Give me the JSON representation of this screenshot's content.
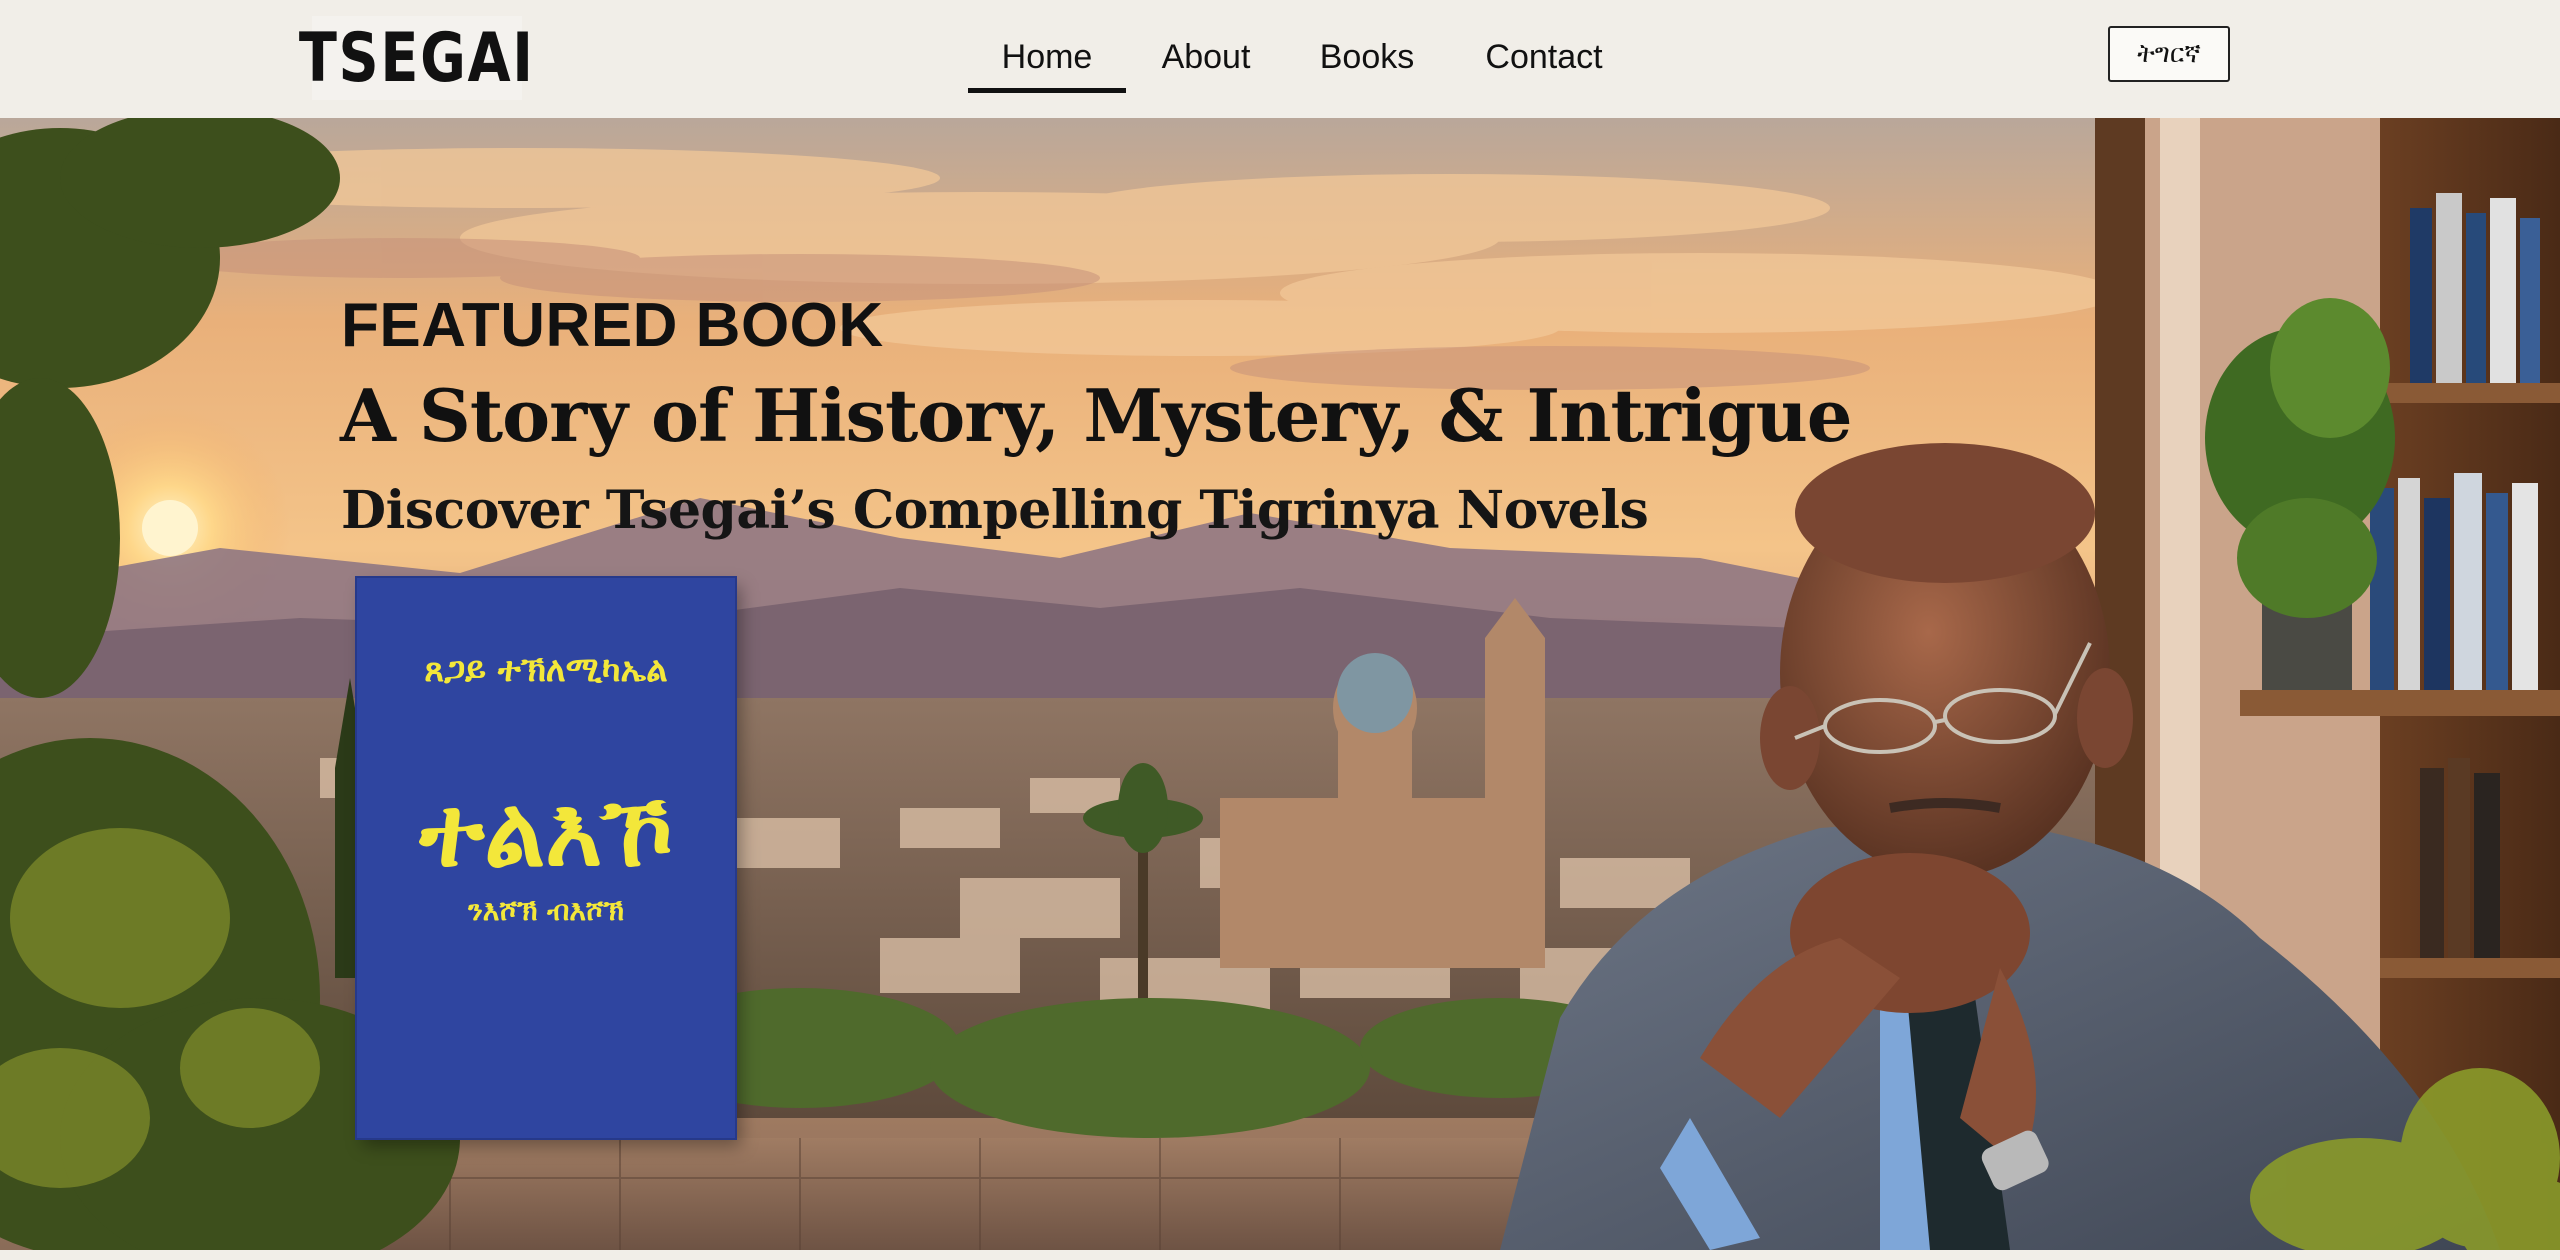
{
  "header": {
    "logo_text": "TSEGAI",
    "nav": [
      {
        "label": "Home",
        "active": true
      },
      {
        "label": "About"
      },
      {
        "label": "Books"
      },
      {
        "label": "Contact"
      }
    ],
    "language_button": "ትግርኛ"
  },
  "hero": {
    "featured_label": "FEATURED BOOK",
    "headline": "A Story of History, Mystery, & Intrigue",
    "subheadline": "Discover Tsegai’s Compelling Tigrinya Novels",
    "book": {
      "author": "ጸጋይ ተኽለሚካኤል",
      "title": "ተልእኾ",
      "subtitle": "ንእሾኽ ብእሾኽ",
      "cover_color": "#2f45a0",
      "text_color": "#f3e73a"
    }
  },
  "colors": {
    "header_bg": "#f1eee8",
    "text": "#111111"
  }
}
